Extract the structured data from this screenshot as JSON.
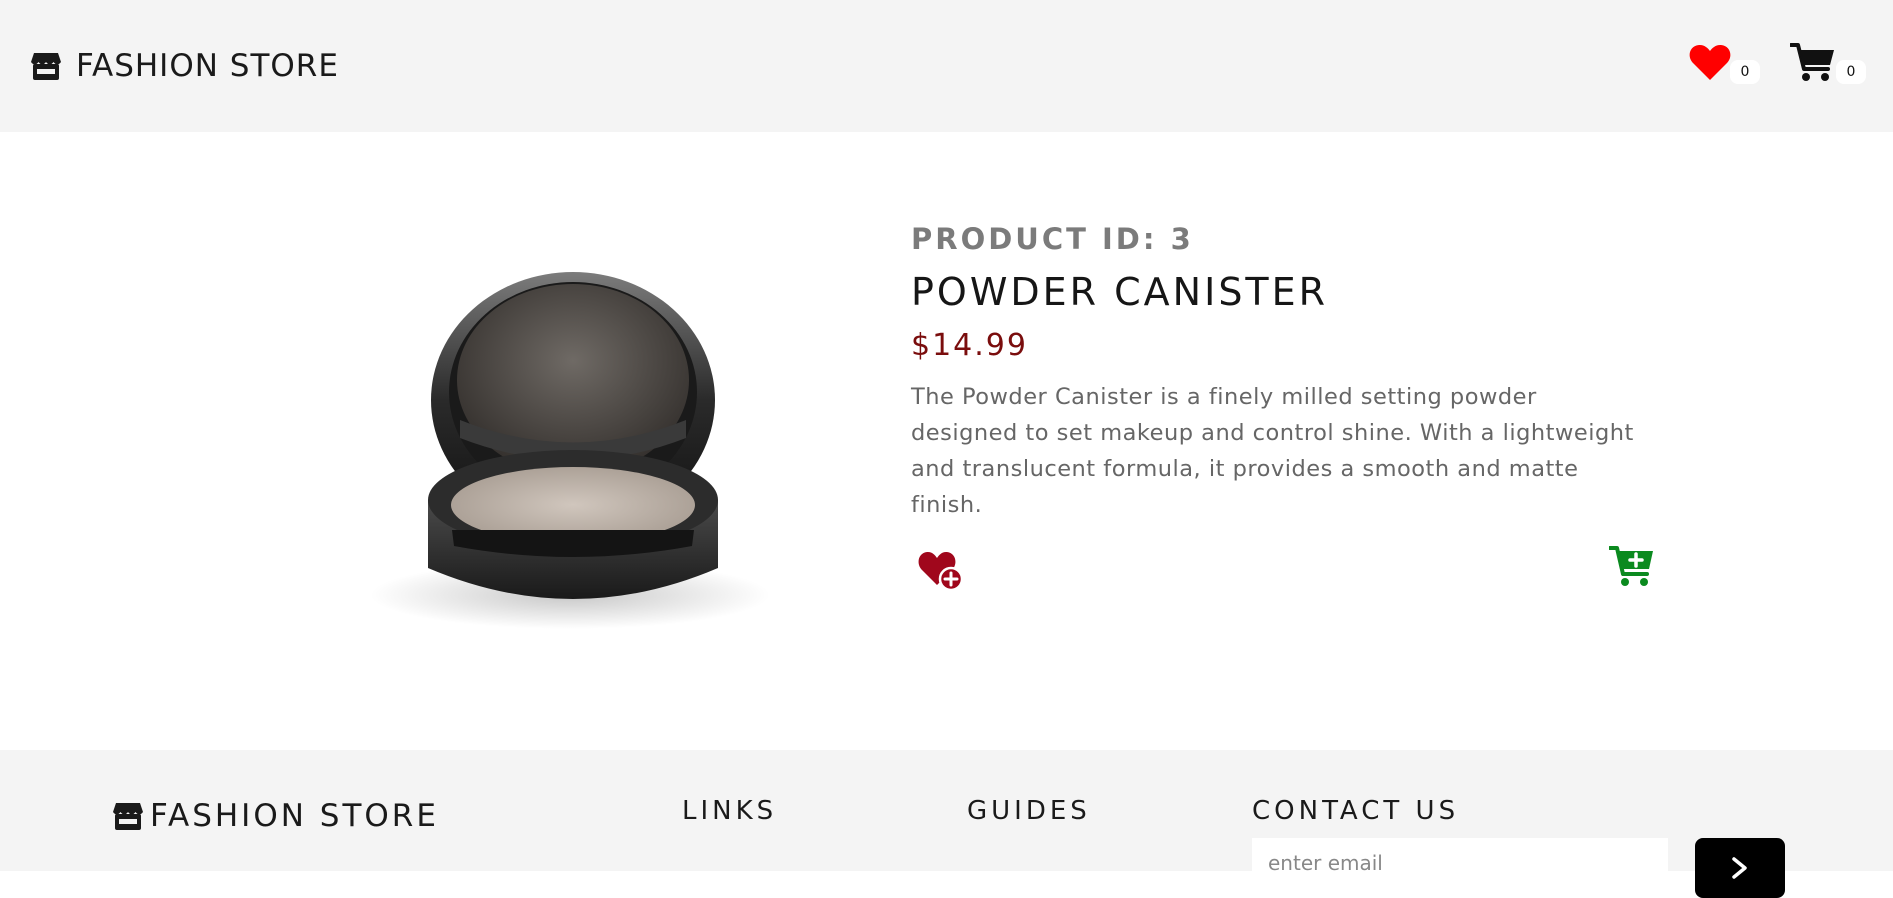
{
  "header": {
    "brand": "FASHION STORE",
    "wishlist_count": "0",
    "cart_count": "0"
  },
  "product": {
    "id_label": "PRODUCT ID: 3",
    "name": "POWDER CANISTER",
    "price": "$14.99",
    "description": "The Powder Canister is a finely milled setting powder designed to set makeup and control shine. With a lightweight and translucent formula, it provides a smooth and matte finish."
  },
  "footer": {
    "brand": "FASHION STORE",
    "links_heading": "LINKS",
    "guides_heading": "GUIDES",
    "contact_heading": "CONTACT US",
    "email_placeholder": "enter email"
  },
  "icons": {
    "store": "store-icon",
    "wishlist": "heart-icon",
    "cart": "cart-icon",
    "add_wishlist": "heart-plus-icon",
    "add_cart": "cart-plus-icon",
    "submit": "chevron-right-icon"
  },
  "colors": {
    "header_bg": "#f4f4f4",
    "heart": "#ff0000",
    "price": "#7a0d0d",
    "add_wishlist": "#a0071c",
    "add_cart": "#0b8a1f"
  }
}
